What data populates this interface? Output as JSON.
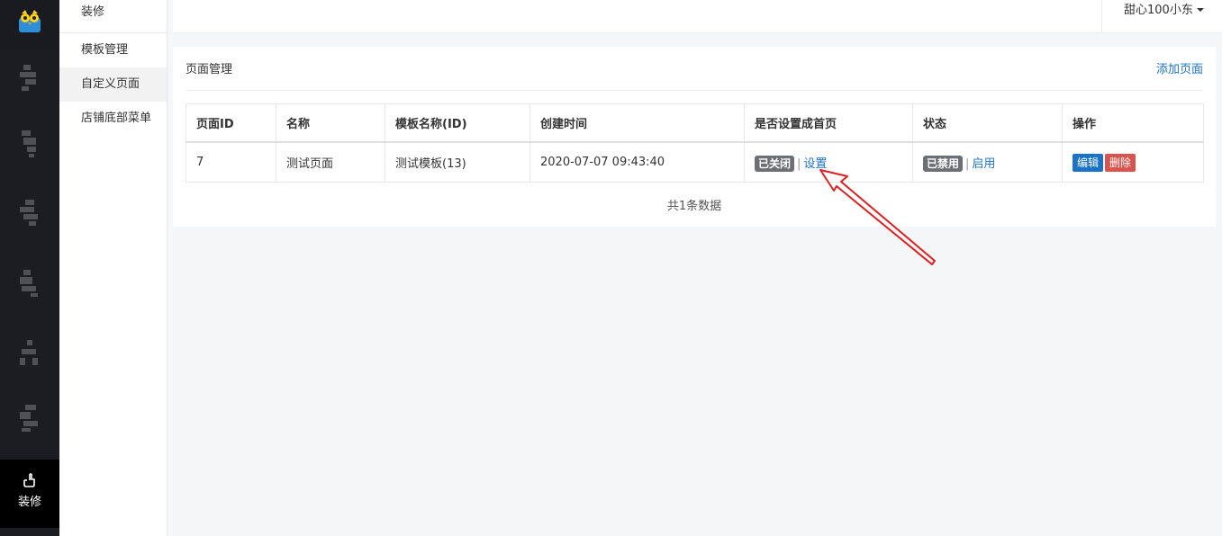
{
  "app": {
    "brand_icon": "owl-logo"
  },
  "rail": {
    "active_label": "装修",
    "active_icon": "hand-icon"
  },
  "submenu": {
    "title": "装修",
    "items": [
      {
        "label": "模板管理",
        "active": false
      },
      {
        "label": "自定义页面",
        "active": true
      },
      {
        "label": "店铺底部菜单",
        "active": false
      }
    ]
  },
  "header": {
    "user_name": "甜心100小东"
  },
  "main": {
    "title": "页面管理",
    "add_page_label": "添加页面",
    "table": {
      "columns": [
        "页面ID",
        "名称",
        "模板名称(ID)",
        "创建时间",
        "是否设置成首页",
        "状态",
        "操作"
      ],
      "rows": [
        {
          "id": "7",
          "name": "测试页面",
          "template": "测试模板(13)",
          "created": "2020-07-07 09:43:40",
          "home_badge": "已关闭",
          "home_action": "设置",
          "status_badge": "已禁用",
          "status_action": "启用",
          "edit_label": "编辑",
          "delete_label": "删除"
        }
      ]
    },
    "total_text": "共1条数据"
  },
  "colors": {
    "accent": "#1a73c8",
    "danger": "#d9534f",
    "badge": "#6c6f75",
    "annotation": "#e02020"
  }
}
